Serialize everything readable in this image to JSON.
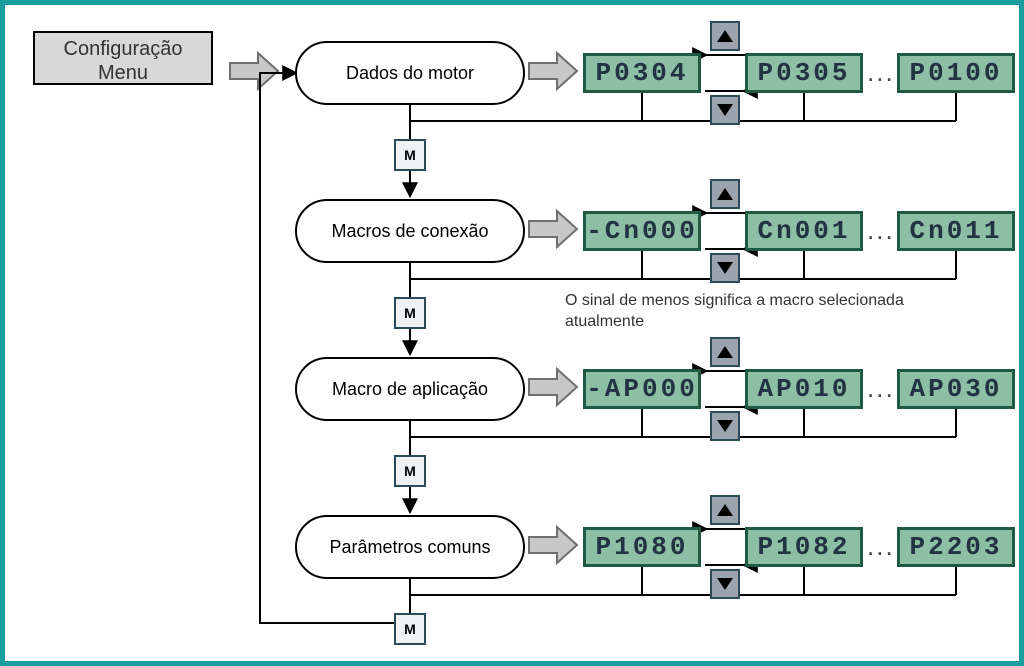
{
  "config": {
    "line1": "Configuração",
    "line2": "Menu"
  },
  "steps": [
    {
      "label": "Dados do motor",
      "lcd": [
        "P0304",
        "P0305",
        "P0100"
      ]
    },
    {
      "label": "Macros de conexão",
      "lcd": [
        "-Cn000",
        "Cn001",
        "Cn011"
      ]
    },
    {
      "label": "Macro de aplicação",
      "lcd": [
        "-AP000",
        "AP010",
        "AP030"
      ]
    },
    {
      "label": "Parâmetros comuns",
      "lcd": [
        "P1080",
        "P1082",
        "P2203"
      ]
    }
  ],
  "ellipsis": "...",
  "m_label": "M",
  "note": "O sinal de menos significa a macro selecionada atualmente"
}
